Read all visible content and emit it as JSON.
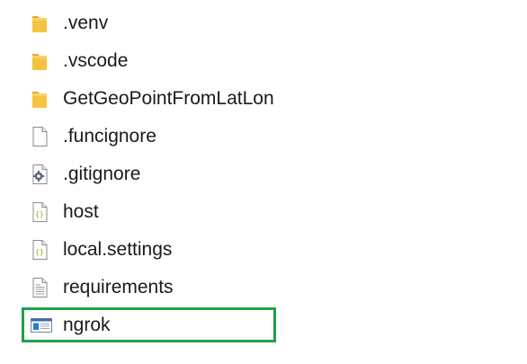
{
  "files": [
    {
      "name": ".venv",
      "type": "folder",
      "icon": "folder-icon"
    },
    {
      "name": ".vscode",
      "type": "folder",
      "icon": "folder-icon"
    },
    {
      "name": "GetGeoPointFromLatLon",
      "type": "folder",
      "icon": "folder-icon"
    },
    {
      "name": ".funcignore",
      "type": "file",
      "icon": "blank-file-icon"
    },
    {
      "name": ".gitignore",
      "type": "file",
      "icon": "settings-file-icon"
    },
    {
      "name": "host",
      "type": "json",
      "icon": "json-file-icon"
    },
    {
      "name": "local.settings",
      "type": "json",
      "icon": "json-file-icon"
    },
    {
      "name": "requirements",
      "type": "text",
      "icon": "text-file-icon"
    },
    {
      "name": "ngrok",
      "type": "application",
      "icon": "application-icon",
      "highlighted": true
    }
  ],
  "colors": {
    "highlight_border": "#1fa14a",
    "folder": "#f5c342",
    "json_brace": "#b9c23a"
  }
}
